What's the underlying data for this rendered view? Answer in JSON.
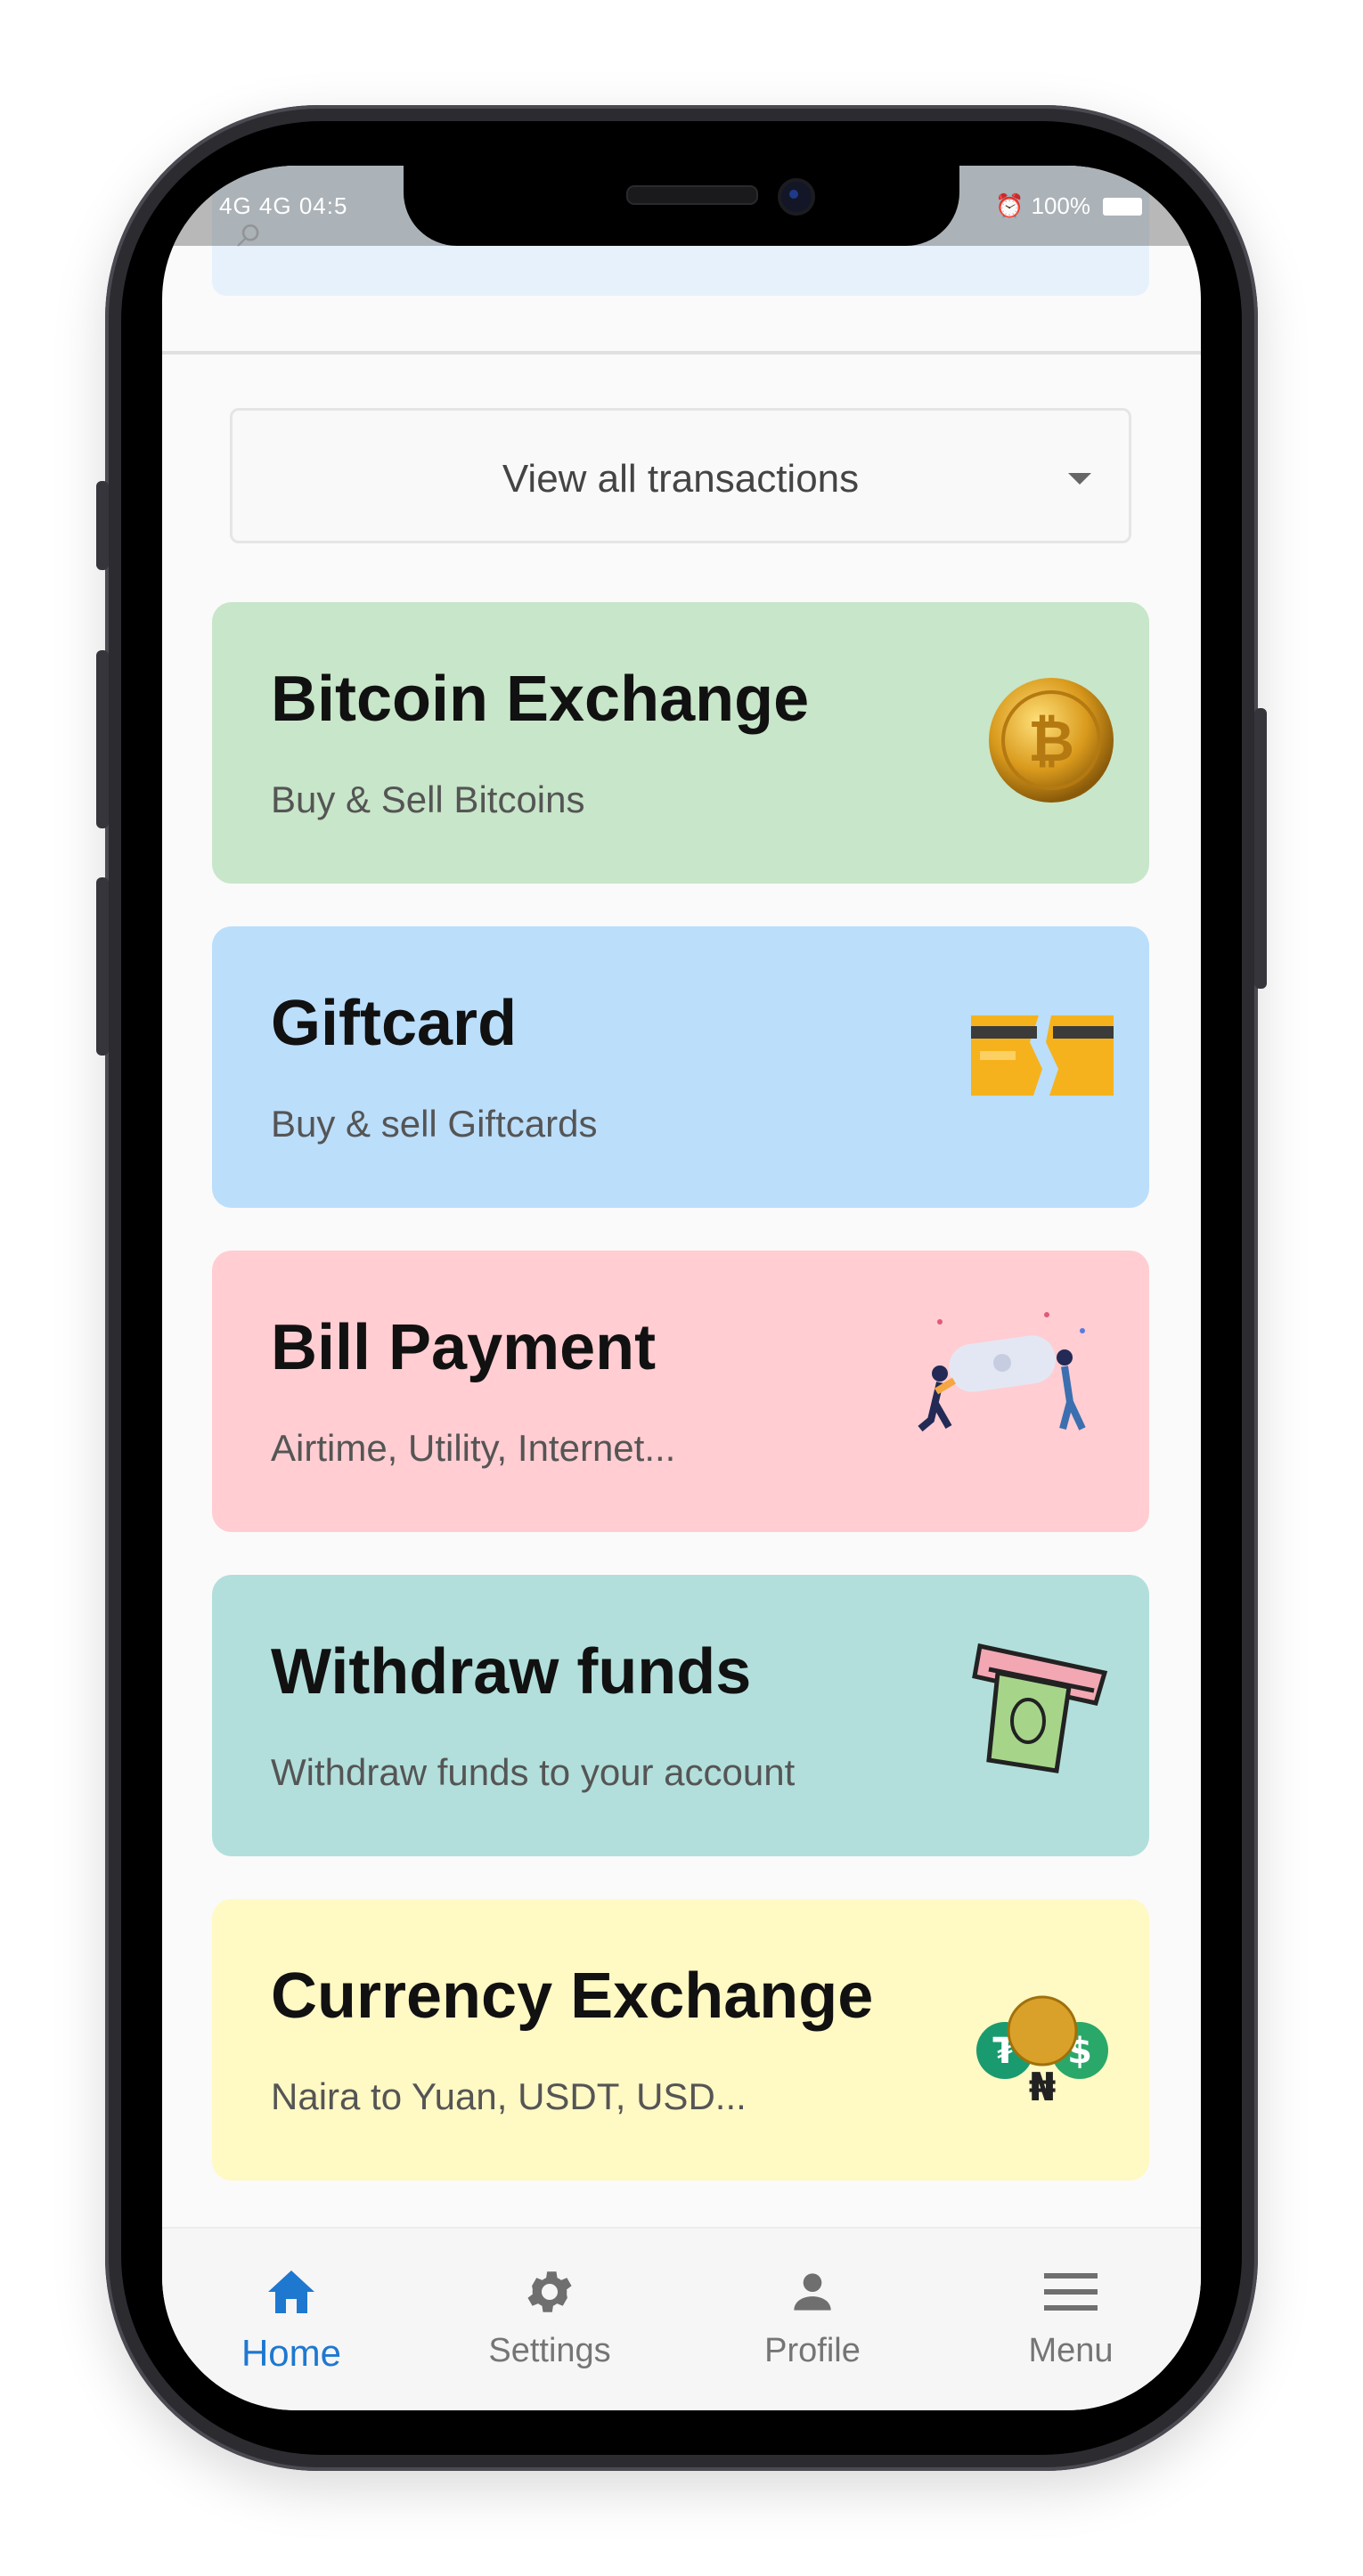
{
  "status_bar": {
    "left": "4G 4G 04:5",
    "right_battery": "100%"
  },
  "search": {
    "icon": "search-icon"
  },
  "transactions_filter": {
    "label": "View all transactions"
  },
  "cards": [
    {
      "title": "Bitcoin Exchange",
      "subtitle": "Buy & Sell Bitcoins",
      "icon": "bitcoin-coin-icon",
      "color": "#c8e6c9"
    },
    {
      "title": "Giftcard",
      "subtitle": "Buy & sell Giftcards",
      "icon": "giftcard-icon",
      "color": "#bbdefb"
    },
    {
      "title": "Bill Payment",
      "subtitle": "Airtime, Utility, Internet...",
      "icon": "bill-payment-illustration",
      "color": "#ffcdd2"
    },
    {
      "title": "Withdraw funds",
      "subtitle": "Withdraw funds to your account",
      "icon": "cash-withdraw-icon",
      "color": "#b2dfdb"
    },
    {
      "title": "Currency Exchange",
      "subtitle": "Naira to Yuan, USDT, USD...",
      "icon": "currency-exchange-icon",
      "color": "#fff9c4"
    }
  ],
  "bottom_nav": [
    {
      "label": "Home",
      "icon": "home-icon",
      "active": true
    },
    {
      "label": "Settings",
      "icon": "gear-icon",
      "active": false
    },
    {
      "label": "Profile",
      "icon": "person-icon",
      "active": false
    },
    {
      "label": "Menu",
      "icon": "hamburger-menu-icon",
      "active": false
    }
  ],
  "colors": {
    "accent": "#1e78d0"
  }
}
